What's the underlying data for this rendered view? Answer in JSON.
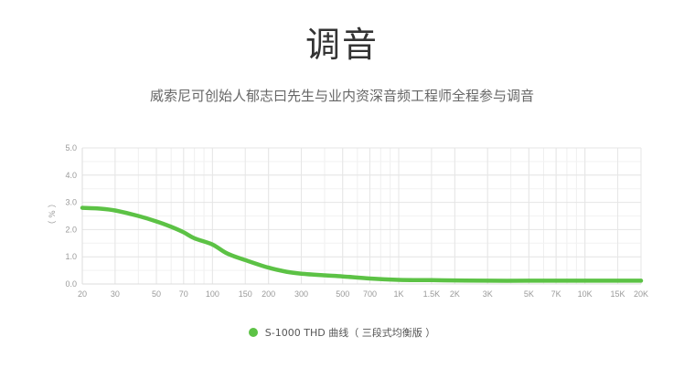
{
  "header": {
    "title": "调音",
    "subtitle": "威索尼可创始人郁志曰先生与业内资深音频工程师全程参与调音"
  },
  "chart_data": {
    "type": "line",
    "xscale": "log",
    "ylabel": "（ % ）",
    "ylim": [
      0,
      5.0
    ],
    "xlim": [
      20,
      20000
    ],
    "grid": true,
    "legend_position": "bottom-center",
    "y_ticks": [
      {
        "value": 0.0,
        "label": "0.0"
      },
      {
        "value": 1.0,
        "label": "1.0"
      },
      {
        "value": 2.0,
        "label": "2.0"
      },
      {
        "value": 3.0,
        "label": "3.0"
      },
      {
        "value": 4.0,
        "label": "4.0"
      },
      {
        "value": 5.0,
        "label": "5.0"
      }
    ],
    "x_ticks": [
      {
        "value": 20,
        "label": "20"
      },
      {
        "value": 30,
        "label": "30"
      },
      {
        "value": 50,
        "label": "50"
      },
      {
        "value": 70,
        "label": "70"
      },
      {
        "value": 100,
        "label": "100"
      },
      {
        "value": 150,
        "label": "150"
      },
      {
        "value": 200,
        "label": "200"
      },
      {
        "value": 300,
        "label": "300"
      },
      {
        "value": 500,
        "label": "500"
      },
      {
        "value": 700,
        "label": "700"
      },
      {
        "value": 1000,
        "label": "1K"
      },
      {
        "value": 1500,
        "label": "1.5K"
      },
      {
        "value": 2000,
        "label": "2K"
      },
      {
        "value": 3000,
        "label": "3K"
      },
      {
        "value": 5000,
        "label": "5K"
      },
      {
        "value": 7000,
        "label": "7K"
      },
      {
        "value": 10000,
        "label": "10K"
      },
      {
        "value": 15000,
        "label": "15K"
      },
      {
        "value": 20000,
        "label": "20K"
      }
    ],
    "series": [
      {
        "name": "S-1000 THD 曲线（ 三段式均衡版 ）",
        "color": "#5cc245",
        "x": [
          20,
          25,
          30,
          40,
          50,
          60,
          70,
          80,
          100,
          120,
          150,
          200,
          250,
          300,
          400,
          500,
          700,
          1000,
          1500,
          2000,
          3000,
          5000,
          7000,
          10000,
          15000,
          20000
        ],
        "y": [
          2.8,
          2.77,
          2.7,
          2.5,
          2.3,
          2.1,
          1.9,
          1.68,
          1.45,
          1.12,
          0.88,
          0.6,
          0.45,
          0.38,
          0.32,
          0.28,
          0.2,
          0.15,
          0.14,
          0.13,
          0.12,
          0.12,
          0.12,
          0.12,
          0.12,
          0.12
        ]
      }
    ]
  }
}
